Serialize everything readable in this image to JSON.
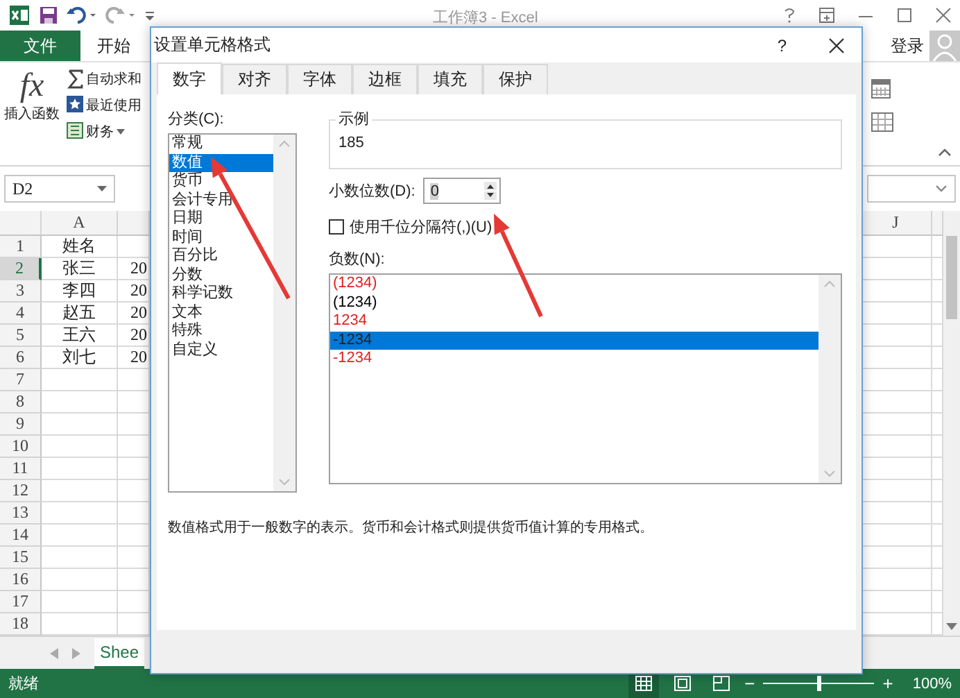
{
  "app": {
    "title": "工作簿3 - Excel",
    "sign_in": "登录"
  },
  "ribbon_tabs": [
    {
      "label": "文件",
      "kind": "file"
    },
    {
      "label": "开始",
      "kind": "tab"
    }
  ],
  "ribbon": {
    "insert_function": {
      "symbol": "fx",
      "label": "插入函数"
    },
    "commands": [
      {
        "kind": "sum",
        "label": "自动求和"
      },
      {
        "kind": "recent",
        "label": "最近使用"
      },
      {
        "kind": "finance",
        "label": "财务"
      }
    ]
  },
  "name_box": {
    "value": "D2"
  },
  "column_headers": [
    "A",
    "J"
  ],
  "rows": [
    {
      "number": "1",
      "selected": false,
      "a": "姓名"
    },
    {
      "number": "2",
      "selected": true,
      "a": "张三",
      "b": "20"
    },
    {
      "number": "3",
      "selected": false,
      "a": "李四",
      "b": "20"
    },
    {
      "number": "4",
      "selected": false,
      "a": "赵五",
      "b": "20"
    },
    {
      "number": "5",
      "selected": false,
      "a": "王六",
      "b": "20"
    },
    {
      "number": "6",
      "selected": false,
      "a": "刘七",
      "b": "20"
    },
    {
      "number": "7",
      "selected": false
    },
    {
      "number": "8",
      "selected": false
    },
    {
      "number": "9",
      "selected": false
    },
    {
      "number": "10",
      "selected": false
    },
    {
      "number": "11",
      "selected": false
    },
    {
      "number": "12",
      "selected": false
    },
    {
      "number": "13",
      "selected": false
    },
    {
      "number": "14",
      "selected": false
    },
    {
      "number": "15",
      "selected": false
    },
    {
      "number": "16",
      "selected": false
    },
    {
      "number": "17",
      "selected": false
    },
    {
      "number": "18",
      "selected": false
    }
  ],
  "sheet_tab": "Shee",
  "status_bar": {
    "text": "就绪",
    "views": [
      {
        "kind": "normal",
        "selected": true
      },
      {
        "kind": "page_layout",
        "selected": false
      },
      {
        "kind": "page_break",
        "selected": false
      }
    ],
    "zoom": {
      "minus": "−",
      "plus": "+",
      "level": 0.5,
      "reading": "100%"
    }
  },
  "dialog": {
    "title": "设置单元格格式",
    "help": "?",
    "tabs": [
      {
        "label": "数字",
        "selected": true
      },
      {
        "label": "对齐",
        "selected": false
      },
      {
        "label": "字体",
        "selected": false
      },
      {
        "label": "边框",
        "selected": false
      },
      {
        "label": "填充",
        "selected": false
      },
      {
        "label": "保护",
        "selected": false
      }
    ],
    "category": {
      "label": "分类(C):",
      "items": [
        {
          "label": "常规",
          "selected": false
        },
        {
          "label": "数值",
          "selected": true
        },
        {
          "label": "货币",
          "selected": false
        },
        {
          "label": "会计专用",
          "selected": false
        },
        {
          "label": "日期",
          "selected": false
        },
        {
          "label": "时间",
          "selected": false
        },
        {
          "label": "百分比",
          "selected": false
        },
        {
          "label": "分数",
          "selected": false
        },
        {
          "label": "科学记数",
          "selected": false
        },
        {
          "label": "文本",
          "selected": false
        },
        {
          "label": "特殊",
          "selected": false
        },
        {
          "label": "自定义",
          "selected": false
        }
      ]
    },
    "sample": {
      "label": "示例",
      "value": "185"
    },
    "decimal_places": {
      "label": "小数位数(D):",
      "value": "0"
    },
    "thousands_separator": {
      "label": "使用千位分隔符(,)(U)",
      "checked": false
    },
    "negative_numbers": {
      "label": "负数(N):",
      "items": [
        {
          "text": "(1234)",
          "color": "#e02020",
          "selected": false
        },
        {
          "text": "(1234)",
          "color": "#000000",
          "selected": false
        },
        {
          "text": "1234",
          "color": "#e02020",
          "selected": false
        },
        {
          "text": "-1234",
          "selected": true
        },
        {
          "text": "-1234",
          "color": "#e02020",
          "selected": false
        }
      ]
    },
    "description": "数值格式用于一般数字的表示。货币和会计格式则提供货币值计算的专用格式。"
  }
}
